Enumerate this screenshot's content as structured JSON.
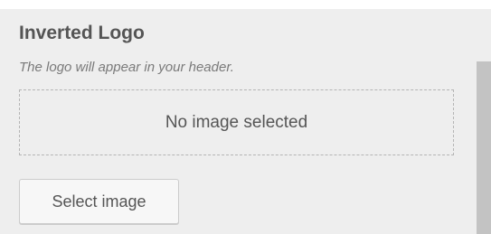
{
  "control": {
    "title": "Inverted Logo",
    "description": "The logo will appear in your header.",
    "placeholder": "No image selected",
    "select_button_label": "Select image"
  },
  "colors": {
    "panel_background": "#eeeeee",
    "title_text": "#555555",
    "description_text": "#7a7a7a",
    "placeholder_border": "#b4b4b4",
    "button_background": "#f7f7f7",
    "button_border": "#cccccc",
    "scrollbar_thumb": "#c3c3c3"
  }
}
